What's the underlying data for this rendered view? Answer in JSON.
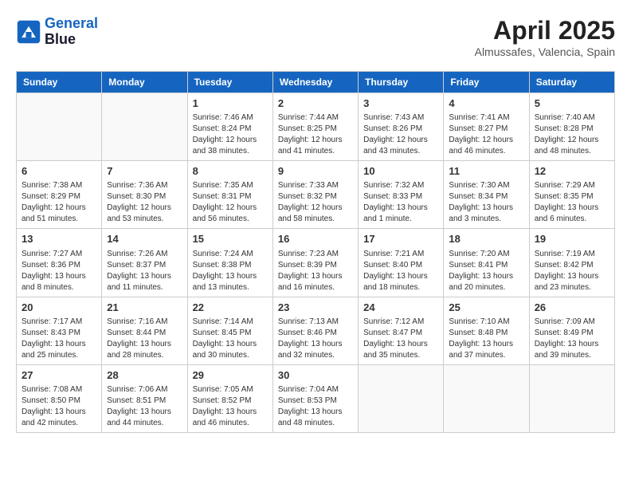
{
  "header": {
    "logo_line1": "General",
    "logo_line2": "Blue",
    "month_title": "April 2025",
    "location": "Almussafes, Valencia, Spain"
  },
  "days_of_week": [
    "Sunday",
    "Monday",
    "Tuesday",
    "Wednesday",
    "Thursday",
    "Friday",
    "Saturday"
  ],
  "weeks": [
    [
      {
        "day": "",
        "info": ""
      },
      {
        "day": "",
        "info": ""
      },
      {
        "day": "1",
        "info": "Sunrise: 7:46 AM\nSunset: 8:24 PM\nDaylight: 12 hours and 38 minutes."
      },
      {
        "day": "2",
        "info": "Sunrise: 7:44 AM\nSunset: 8:25 PM\nDaylight: 12 hours and 41 minutes."
      },
      {
        "day": "3",
        "info": "Sunrise: 7:43 AM\nSunset: 8:26 PM\nDaylight: 12 hours and 43 minutes."
      },
      {
        "day": "4",
        "info": "Sunrise: 7:41 AM\nSunset: 8:27 PM\nDaylight: 12 hours and 46 minutes."
      },
      {
        "day": "5",
        "info": "Sunrise: 7:40 AM\nSunset: 8:28 PM\nDaylight: 12 hours and 48 minutes."
      }
    ],
    [
      {
        "day": "6",
        "info": "Sunrise: 7:38 AM\nSunset: 8:29 PM\nDaylight: 12 hours and 51 minutes."
      },
      {
        "day": "7",
        "info": "Sunrise: 7:36 AM\nSunset: 8:30 PM\nDaylight: 12 hours and 53 minutes."
      },
      {
        "day": "8",
        "info": "Sunrise: 7:35 AM\nSunset: 8:31 PM\nDaylight: 12 hours and 56 minutes."
      },
      {
        "day": "9",
        "info": "Sunrise: 7:33 AM\nSunset: 8:32 PM\nDaylight: 12 hours and 58 minutes."
      },
      {
        "day": "10",
        "info": "Sunrise: 7:32 AM\nSunset: 8:33 PM\nDaylight: 13 hours and 1 minute."
      },
      {
        "day": "11",
        "info": "Sunrise: 7:30 AM\nSunset: 8:34 PM\nDaylight: 13 hours and 3 minutes."
      },
      {
        "day": "12",
        "info": "Sunrise: 7:29 AM\nSunset: 8:35 PM\nDaylight: 13 hours and 6 minutes."
      }
    ],
    [
      {
        "day": "13",
        "info": "Sunrise: 7:27 AM\nSunset: 8:36 PM\nDaylight: 13 hours and 8 minutes."
      },
      {
        "day": "14",
        "info": "Sunrise: 7:26 AM\nSunset: 8:37 PM\nDaylight: 13 hours and 11 minutes."
      },
      {
        "day": "15",
        "info": "Sunrise: 7:24 AM\nSunset: 8:38 PM\nDaylight: 13 hours and 13 minutes."
      },
      {
        "day": "16",
        "info": "Sunrise: 7:23 AM\nSunset: 8:39 PM\nDaylight: 13 hours and 16 minutes."
      },
      {
        "day": "17",
        "info": "Sunrise: 7:21 AM\nSunset: 8:40 PM\nDaylight: 13 hours and 18 minutes."
      },
      {
        "day": "18",
        "info": "Sunrise: 7:20 AM\nSunset: 8:41 PM\nDaylight: 13 hours and 20 minutes."
      },
      {
        "day": "19",
        "info": "Sunrise: 7:19 AM\nSunset: 8:42 PM\nDaylight: 13 hours and 23 minutes."
      }
    ],
    [
      {
        "day": "20",
        "info": "Sunrise: 7:17 AM\nSunset: 8:43 PM\nDaylight: 13 hours and 25 minutes."
      },
      {
        "day": "21",
        "info": "Sunrise: 7:16 AM\nSunset: 8:44 PM\nDaylight: 13 hours and 28 minutes."
      },
      {
        "day": "22",
        "info": "Sunrise: 7:14 AM\nSunset: 8:45 PM\nDaylight: 13 hours and 30 minutes."
      },
      {
        "day": "23",
        "info": "Sunrise: 7:13 AM\nSunset: 8:46 PM\nDaylight: 13 hours and 32 minutes."
      },
      {
        "day": "24",
        "info": "Sunrise: 7:12 AM\nSunset: 8:47 PM\nDaylight: 13 hours and 35 minutes."
      },
      {
        "day": "25",
        "info": "Sunrise: 7:10 AM\nSunset: 8:48 PM\nDaylight: 13 hours and 37 minutes."
      },
      {
        "day": "26",
        "info": "Sunrise: 7:09 AM\nSunset: 8:49 PM\nDaylight: 13 hours and 39 minutes."
      }
    ],
    [
      {
        "day": "27",
        "info": "Sunrise: 7:08 AM\nSunset: 8:50 PM\nDaylight: 13 hours and 42 minutes."
      },
      {
        "day": "28",
        "info": "Sunrise: 7:06 AM\nSunset: 8:51 PM\nDaylight: 13 hours and 44 minutes."
      },
      {
        "day": "29",
        "info": "Sunrise: 7:05 AM\nSunset: 8:52 PM\nDaylight: 13 hours and 46 minutes."
      },
      {
        "day": "30",
        "info": "Sunrise: 7:04 AM\nSunset: 8:53 PM\nDaylight: 13 hours and 48 minutes."
      },
      {
        "day": "",
        "info": ""
      },
      {
        "day": "",
        "info": ""
      },
      {
        "day": "",
        "info": ""
      }
    ]
  ]
}
